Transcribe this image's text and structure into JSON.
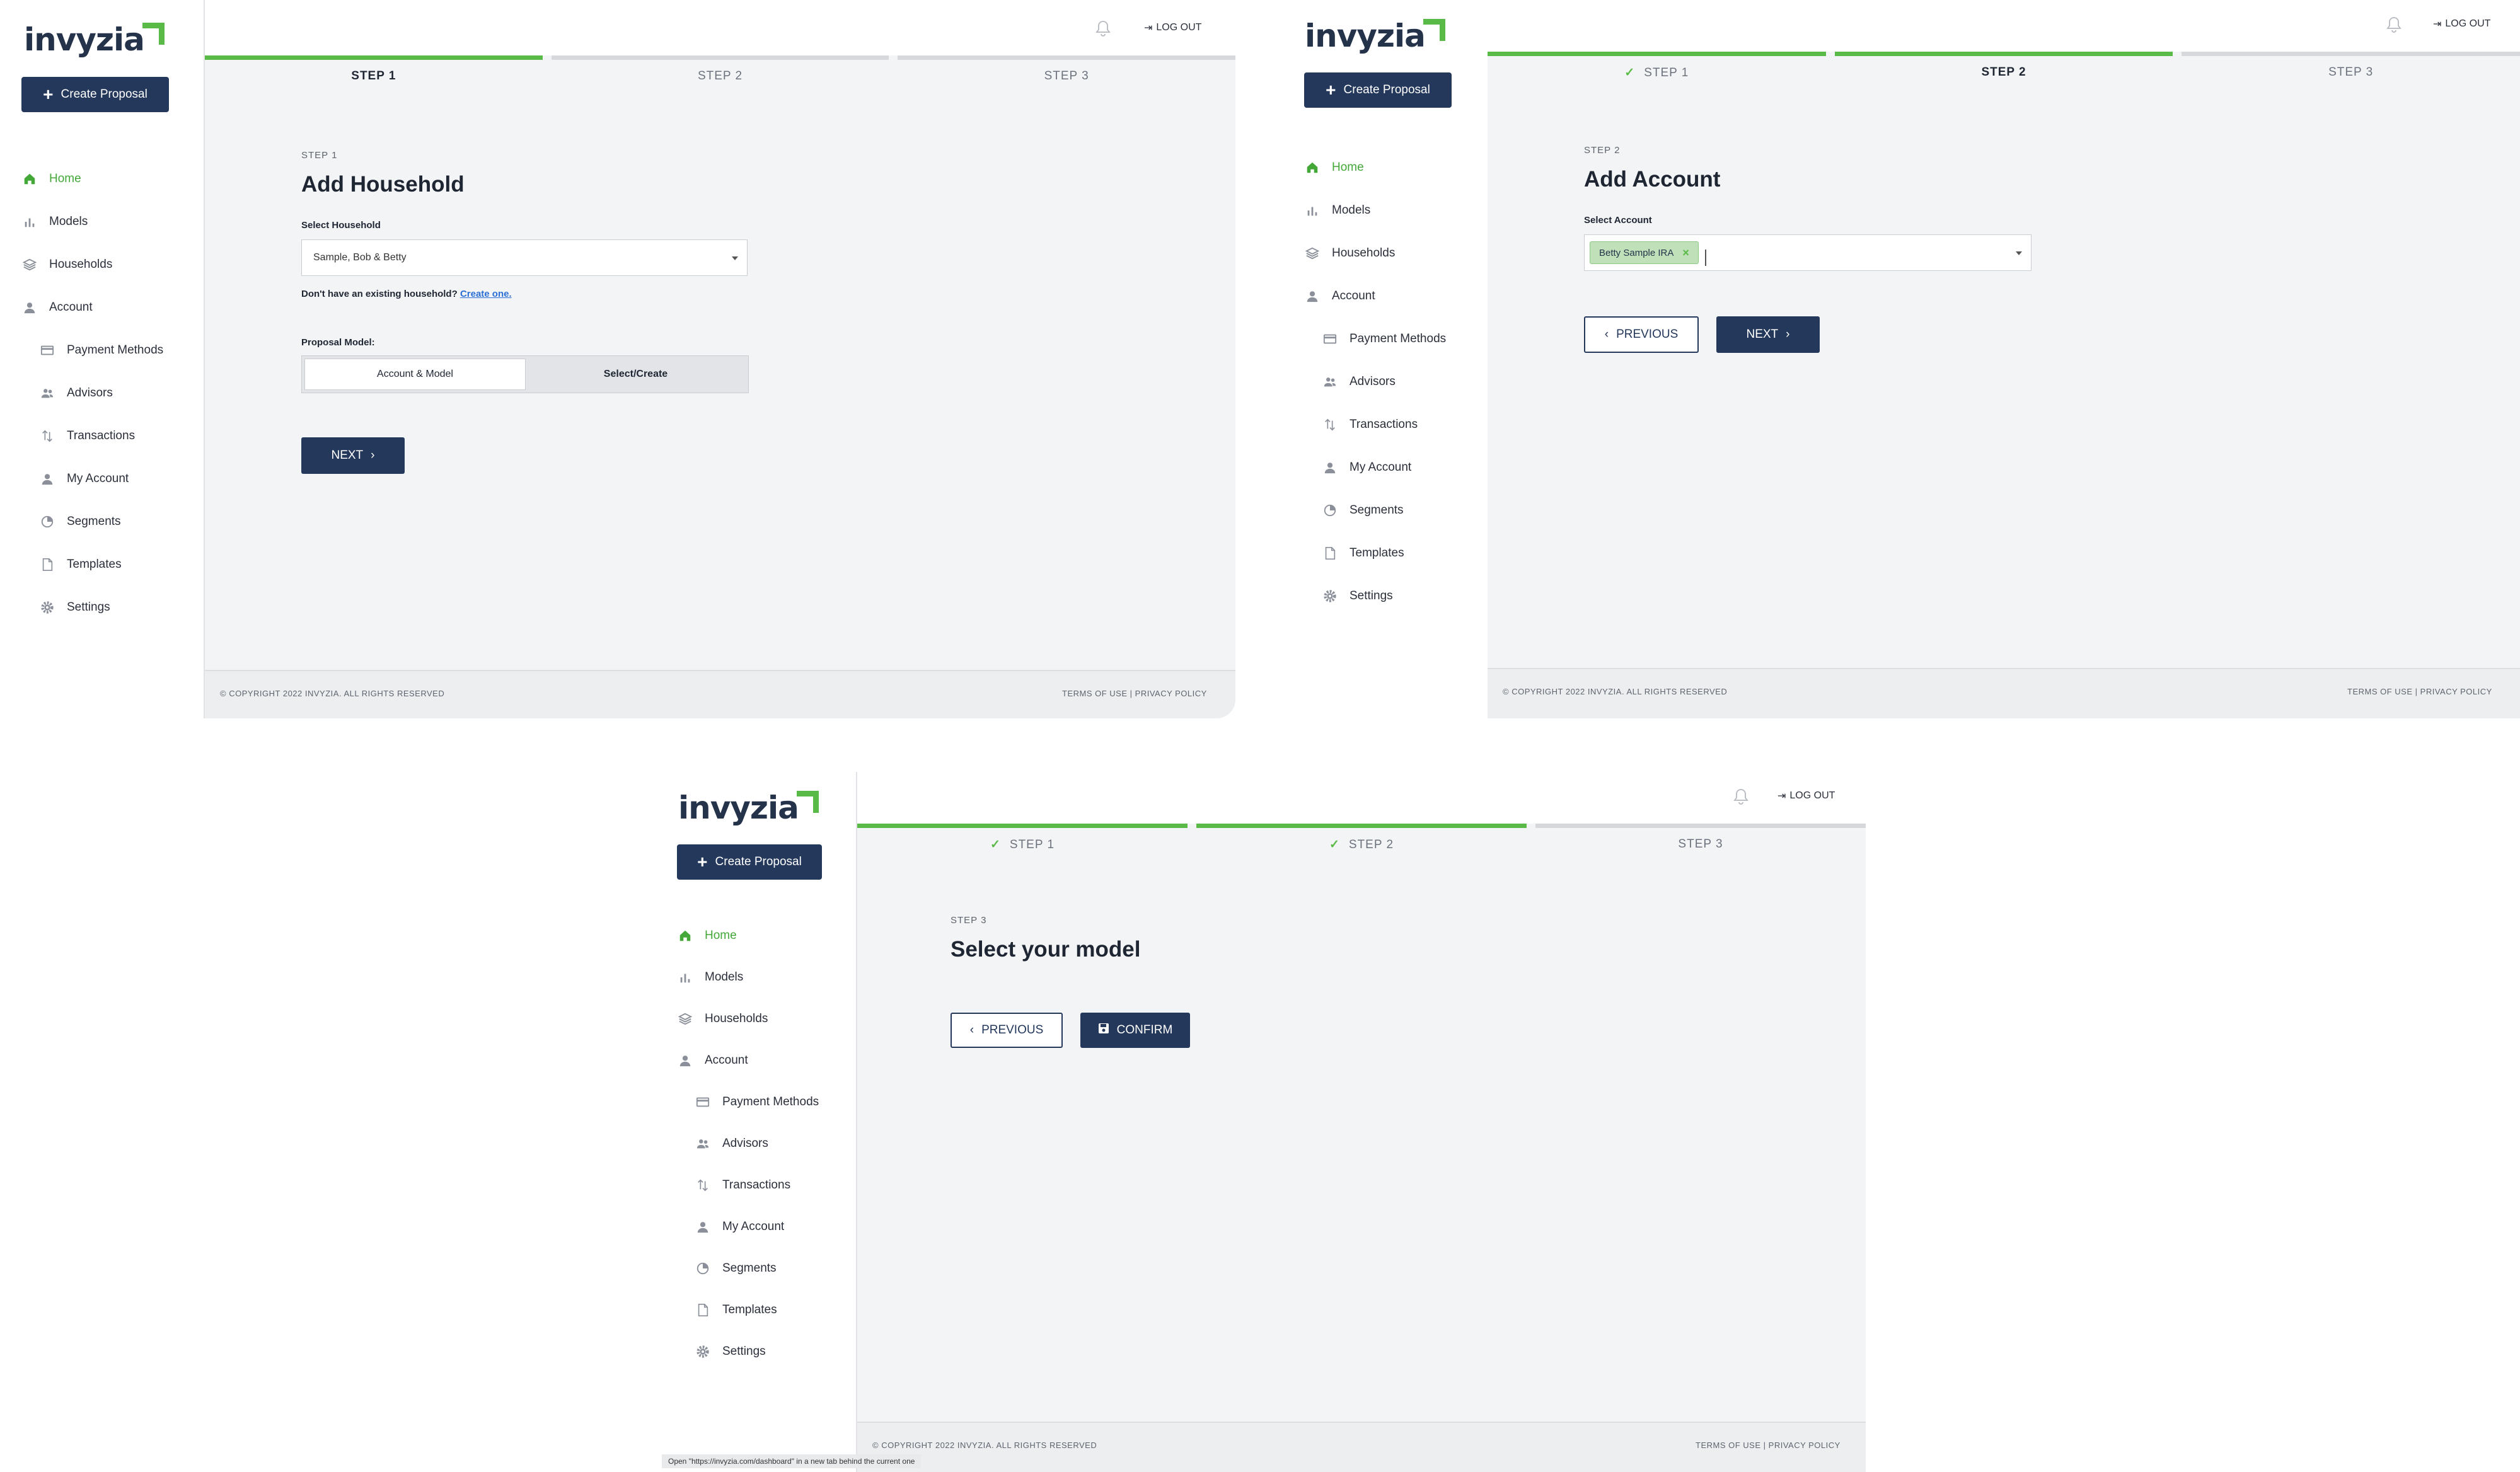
{
  "brand": {
    "name": "invyzia"
  },
  "sidebar": {
    "create_label": "Create Proposal",
    "items": [
      {
        "label": "Home",
        "icon": "home-icon",
        "active": true,
        "sub": false
      },
      {
        "label": "Models",
        "icon": "bar-chart-icon",
        "active": false,
        "sub": false
      },
      {
        "label": "Households",
        "icon": "layers-icon",
        "active": false,
        "sub": false
      },
      {
        "label": "Account",
        "icon": "user-icon",
        "active": false,
        "sub": false
      },
      {
        "label": "Payment Methods",
        "icon": "credit-card-icon",
        "active": false,
        "sub": true
      },
      {
        "label": "Advisors",
        "icon": "users-icon",
        "active": false,
        "sub": true
      },
      {
        "label": "Transactions",
        "icon": "transfer-icon",
        "active": false,
        "sub": true
      },
      {
        "label": "My Account",
        "icon": "user-icon",
        "active": false,
        "sub": true
      },
      {
        "label": "Segments",
        "icon": "pie-chart-icon",
        "active": false,
        "sub": true
      },
      {
        "label": "Templates",
        "icon": "file-icon",
        "active": false,
        "sub": true
      },
      {
        "label": "Settings",
        "icon": "gear-icon",
        "active": false,
        "sub": true
      }
    ]
  },
  "topbar": {
    "logout": "LOG OUT"
  },
  "steps": {
    "s1": "STEP 1",
    "s2": "STEP 2",
    "s3": "STEP 3"
  },
  "footer": {
    "copyright": "© COPYRIGHT 2022 INVYZIA. ALL RIGHTS RESERVED",
    "terms": "TERMS OF USE",
    "sep": "|",
    "privacy": "PRIVACY POLICY"
  },
  "screen1": {
    "eyebrow": "STEP 1",
    "title": "Add Household",
    "select_label": "Select Household",
    "select_value": "Sample, Bob & Betty",
    "hint": "Don't have an existing household?",
    "hint_link": "Create one.",
    "model_label": "Proposal Model:",
    "opt_a": "Account & Model",
    "opt_b": "Select/Create",
    "next": "NEXT"
  },
  "screen2": {
    "eyebrow": "STEP 2",
    "title": "Add Account",
    "select_label": "Select Account",
    "chip": "Betty Sample IRA",
    "previous": "PREVIOUS",
    "next": "NEXT"
  },
  "screen3": {
    "eyebrow": "STEP 3",
    "title": "Select your model",
    "previous": "PREVIOUS",
    "confirm": "CONFIRM",
    "status": "Open \"https://invyzia.com/dashboard\" in a new tab behind the current one"
  }
}
